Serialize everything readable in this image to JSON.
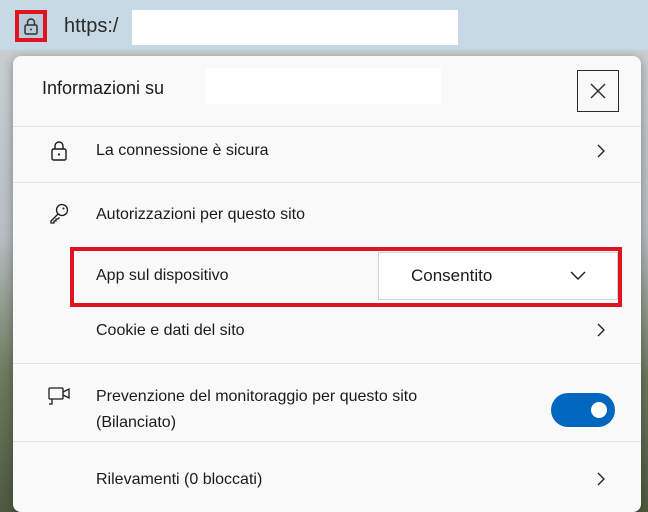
{
  "address_bar": {
    "url_text": "https:/"
  },
  "panel": {
    "title": "Informazioni su",
    "connection": {
      "label": "La connessione è sicura"
    },
    "permissions": {
      "heading": "Autorizzazioni per questo sito",
      "device_apps": {
        "label": "App sul dispositivo",
        "selected": "Consentito"
      },
      "cookies": {
        "label": "Cookie e dati del sito"
      }
    },
    "tracking": {
      "label_line1": "Prevenzione del monitoraggio per questo sito",
      "label_line2": "(Bilanciato)",
      "enabled": true,
      "detections": {
        "label": "Rilevamenti (0 bloccati)"
      }
    }
  },
  "colors": {
    "highlight": "#e0141e",
    "toggle_on": "#0067c0",
    "address_bar": "#c8d9e6",
    "panel_bg": "#f9f9f9"
  },
  "icons": [
    "lock-icon",
    "close-icon",
    "key-icon",
    "camera-icon",
    "chevron-right-icon",
    "chevron-down-icon"
  ]
}
